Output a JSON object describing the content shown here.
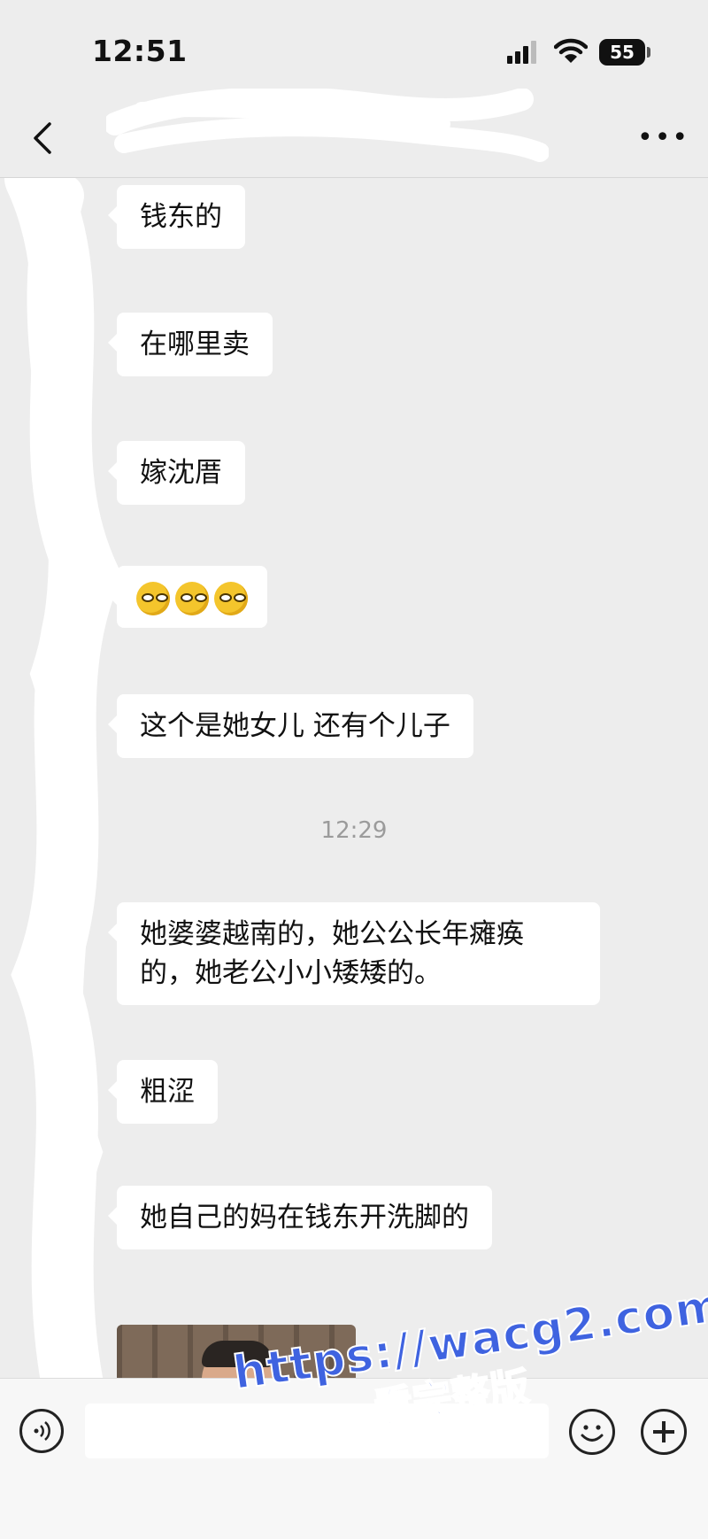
{
  "status_bar": {
    "time": "12:51",
    "battery": "55"
  },
  "nav": {
    "back_icon": "chevron-left-icon",
    "more_icon": "more-dots-icon"
  },
  "messages": [
    {
      "type": "text",
      "text": "钱东的"
    },
    {
      "type": "text",
      "text": "在哪里卖"
    },
    {
      "type": "text",
      "text": "嫁沈厝"
    },
    {
      "type": "emoji",
      "emoji": "smirk-face-emoji",
      "count": 3
    },
    {
      "type": "text",
      "text": "这个是她女儿 还有个儿子"
    },
    {
      "type": "timestamp",
      "text": "12:29"
    },
    {
      "type": "text",
      "text": "她婆婆越南的，她公公长年瘫痪的，她老公小小矮矮的。"
    },
    {
      "type": "text",
      "text": "粗涩"
    },
    {
      "type": "text",
      "text": "她自己的妈在钱东开洗脚的"
    },
    {
      "type": "image",
      "image": "photo-thumbnail"
    }
  ],
  "input_bar": {
    "voice_icon": "voice-icon",
    "emoji_icon": "emoji-icon",
    "plus_icon": "plus-icon"
  },
  "watermark": {
    "url": "https://wacg2.com",
    "caption": "看完整版"
  },
  "colors": {
    "background": "#ededed",
    "bubble": "#ffffff",
    "watermark": "#3f63e0"
  }
}
